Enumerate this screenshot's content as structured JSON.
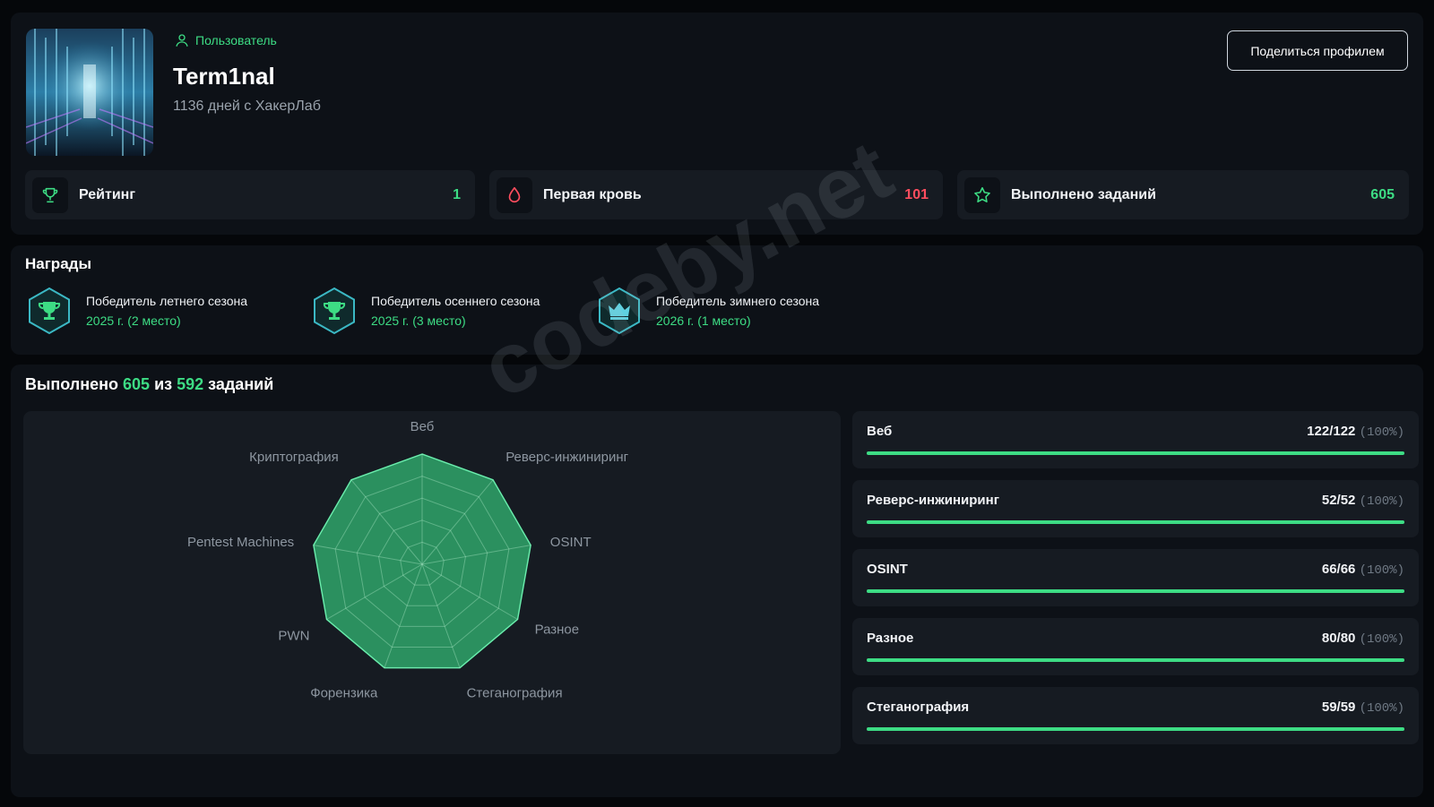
{
  "profile": {
    "role": "Пользователь",
    "username": "Term1nal",
    "days": "1136 дней с ХакерЛаб",
    "share_label": "Поделиться профилем"
  },
  "stats": [
    {
      "label": "Рейтинг",
      "value": "1",
      "icon": "trophy-icon",
      "color": "#3ddc84"
    },
    {
      "label": "Первая кровь",
      "value": "101",
      "icon": "blood-drop-icon",
      "color": "#ff4d5e"
    },
    {
      "label": "Выполнено заданий",
      "value": "605",
      "icon": "star-icon",
      "color": "#3ddc84"
    }
  ],
  "awards": {
    "title": "Награды",
    "items": [
      {
        "line1": "Победитель летнего сезона",
        "line2": "2025 г. (2 место)",
        "icon": "trophy-badge-icon"
      },
      {
        "line1": "Победитель осеннего сезона",
        "line2": "2025 г. (3 место)",
        "icon": "trophy-badge-icon"
      },
      {
        "line1": "Победитель зимнего сезона",
        "line2": "2026 г. (1 место)",
        "icon": "crown-badge-icon"
      }
    ]
  },
  "tasks": {
    "prefix": "Выполнено",
    "done": "605",
    "middle": "из",
    "total": "592",
    "suffix": "заданий"
  },
  "chart_data": {
    "type": "radar",
    "categories": [
      "Веб",
      "Реверс-инжиниринг",
      "OSINT",
      "Разное",
      "Стеганография",
      "Форензика",
      "PWN",
      "Pentest Machines",
      "Криптография"
    ],
    "values": [
      100,
      100,
      100,
      100,
      100,
      100,
      100,
      100,
      100
    ],
    "rmax": 100,
    "rings": 5,
    "fill_color": "#2fa56a"
  },
  "categories": [
    {
      "name": "Веб",
      "count": "122/122",
      "pct": "(100%)",
      "progress": 1.0
    },
    {
      "name": "Реверс-инжиниринг",
      "count": "52/52",
      "pct": "(100%)",
      "progress": 1.0
    },
    {
      "name": "OSINT",
      "count": "66/66",
      "pct": "(100%)",
      "progress": 1.0
    },
    {
      "name": "Разное",
      "count": "80/80",
      "pct": "(100%)",
      "progress": 1.0
    },
    {
      "name": "Стеганография",
      "count": "59/59",
      "pct": "(100%)",
      "progress": 1.0
    }
  ],
  "watermark": "codeby.net"
}
